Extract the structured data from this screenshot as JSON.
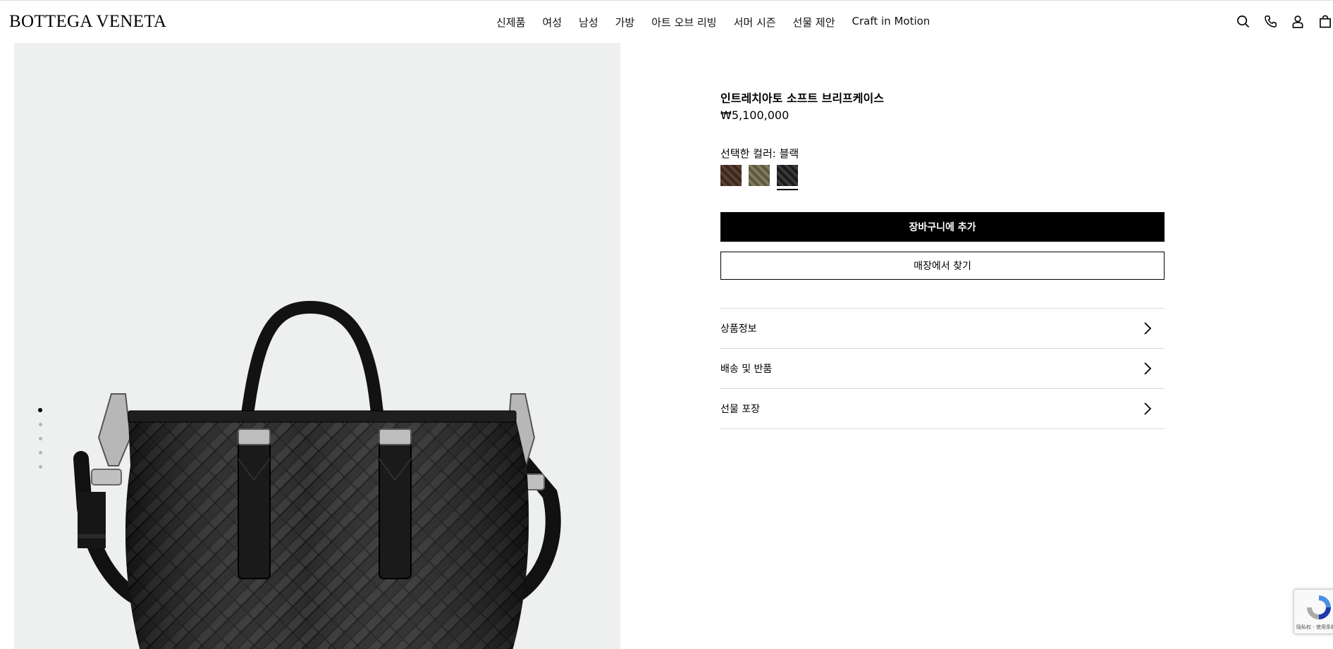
{
  "header": {
    "logo": "BOTTEGA VENETA",
    "nav": [
      "신제품",
      "여성",
      "남성",
      "가방",
      "아트 오브 리빙",
      "서머 시즌",
      "선물 제안",
      "Craft in Motion"
    ],
    "icons": [
      "search-icon",
      "phone-icon",
      "account-icon",
      "bag-icon"
    ]
  },
  "gallery": {
    "slide_count": 5,
    "active_slide": 1
  },
  "product": {
    "title": "인트레치아토 소프트 브리프케이스",
    "price": "₩5,100,000",
    "color_label": "선택한 컬러: 블랙",
    "swatches": [
      {
        "name": "brown-swatch",
        "color": "#4a3328",
        "selected": false
      },
      {
        "name": "olive-swatch",
        "color": "#6f6a4c",
        "selected": false
      },
      {
        "name": "black-swatch",
        "color": "#2a2a2a",
        "selected": true
      }
    ],
    "add_to_cart": "장바구니에 추가",
    "find_in_store": "매장에서 찾기",
    "accordion": [
      "상품정보",
      "배송 및 반품",
      "선물 포장"
    ]
  },
  "recaptcha": {
    "text": "隐私权 - 使用条款"
  }
}
